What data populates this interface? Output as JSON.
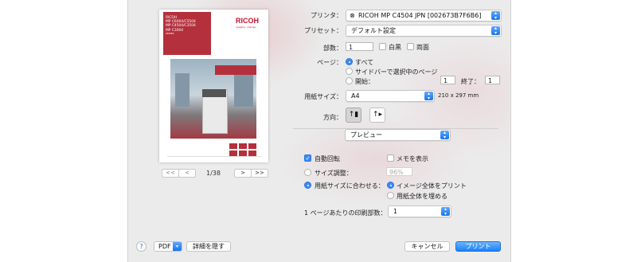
{
  "preview": {
    "brochure_title_lines": [
      "RICOH",
      "MP C6004/C5504",
      "MP C4504/C3504",
      "MP C3004"
    ],
    "brochure_series": "SERIES",
    "logo_text": "RICOH",
    "logo_tagline": "imagine. change.",
    "page_indicator": "1/38",
    "nav_first": "<<",
    "nav_prev": "<",
    "nav_next": ">",
    "nav_last": ">>"
  },
  "form": {
    "printer_label": "プリンタ：",
    "printer_value": "RICOH MP C4504 JPN [002673B7F6B6]",
    "preset_label": "プリセット：",
    "preset_value": "デフォルト設定",
    "copies_label": "部数：",
    "copies_value": "1",
    "bw_label": "白黒",
    "duplex_label": "両面",
    "pages_label": "ページ：",
    "pages_all": "すべて",
    "pages_sidebar": "サイドバーで選択中のページ",
    "pages_start_label": "開始：",
    "pages_start_value": "1",
    "pages_end_label": "終了：",
    "pages_end_value": "1",
    "paper_size_label": "用紙サイズ：",
    "paper_size_value": "A4",
    "paper_size_dims": "210 x 297 mm",
    "orientation_label": "方向：",
    "section_value": "プレビュー",
    "auto_rotate_label": "自動回転",
    "show_notes_label": "メモを表示",
    "scale_label": "サイズ調整：",
    "scale_value": "96%",
    "fit_label": "用紙サイズに合わせる：",
    "fit_print_entire": "イメージ全体をプリント",
    "fit_fill_paper": "用紙全体を埋める",
    "pages_per_sheet_label": "1 ページあたりの印刷部数：",
    "pages_per_sheet_value": "1"
  },
  "footer": {
    "help": "?",
    "pdf_label": "PDF",
    "hide_details": "詳細を隠す",
    "cancel": "キャンセル",
    "print": "プリント"
  }
}
